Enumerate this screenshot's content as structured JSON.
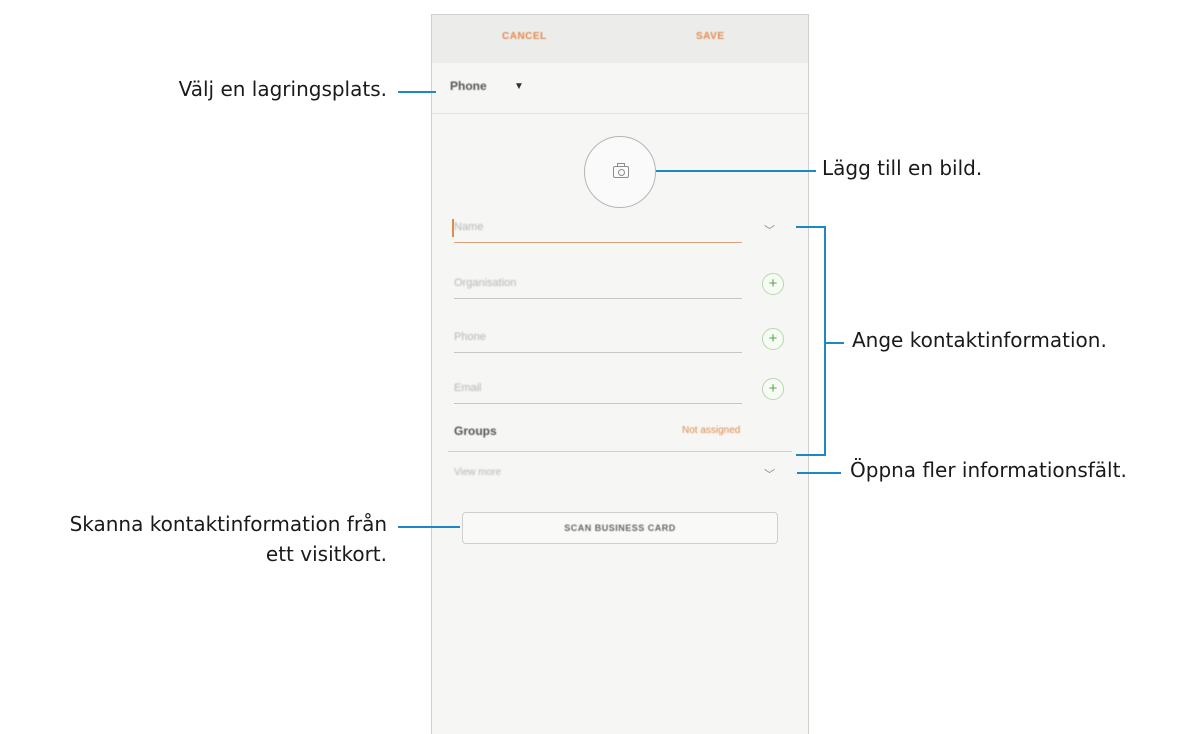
{
  "app": {
    "cancel_label": "CANCEL",
    "save_label": "SAVE",
    "storage_label": "Phone",
    "fields": {
      "name": "Name",
      "organisation": "Organisation",
      "phone": "Phone",
      "email": "Email"
    },
    "groups_label": "Groups",
    "groups_value": "Not assigned",
    "view_more": "View more",
    "scan_button": "SCAN BUSINESS CARD"
  },
  "annotations": {
    "storage": "Välj en lagringsplats.",
    "photo": "Lägg till en bild.",
    "contact_info": "Ange kontaktinformation.",
    "more_fields": "Öppna fler informationsfält.",
    "scan_line1": "Skanna kontaktinformation från",
    "scan_line2": "ett visitkort."
  },
  "colors": {
    "accent": "#e38b4c",
    "annotation_line": "#1e88c7",
    "plus_green": "#5aa24e"
  },
  "icons": [
    "dropdown-caret-icon",
    "camera-icon",
    "chevron-down-icon",
    "plus-icon"
  ]
}
